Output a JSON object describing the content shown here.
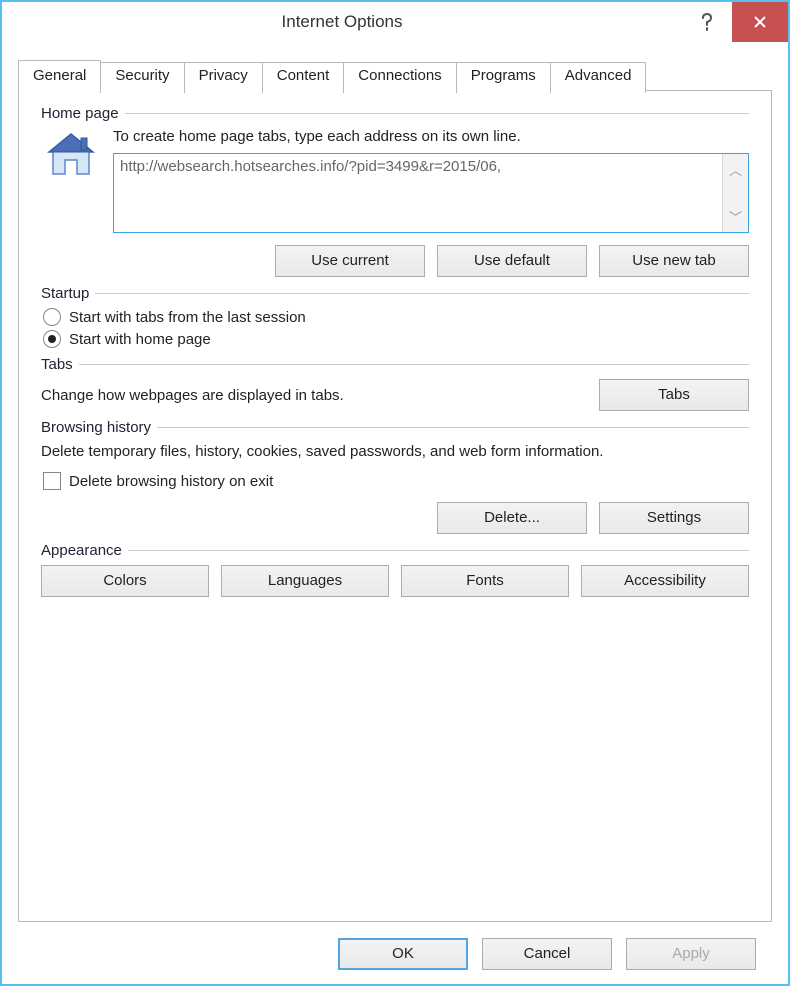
{
  "title": "Internet Options",
  "tabs": [
    "General",
    "Security",
    "Privacy",
    "Content",
    "Connections",
    "Programs",
    "Advanced"
  ],
  "homepage": {
    "group": "Home page",
    "instr": "To create home page tabs, type each address on its own line.",
    "value": "http://websearch.hotsearches.info/?pid=3499&r=2015/06,",
    "use_current": "Use current",
    "use_default": "Use default",
    "use_new_tab": "Use new tab"
  },
  "startup": {
    "group": "Startup",
    "opt_last": "Start with tabs from the last session",
    "opt_home": "Start with home page"
  },
  "tabsec": {
    "group": "Tabs",
    "text": "Change how webpages are displayed in tabs.",
    "btn": "Tabs"
  },
  "history": {
    "group": "Browsing history",
    "text": "Delete temporary files, history, cookies, saved passwords, and web form information.",
    "chk": "Delete browsing history on exit",
    "delete": "Delete...",
    "settings": "Settings"
  },
  "appearance": {
    "group": "Appearance",
    "colors": "Colors",
    "languages": "Languages",
    "fonts": "Fonts",
    "accessibility": "Accessibility"
  },
  "footer": {
    "ok": "OK",
    "cancel": "Cancel",
    "apply": "Apply"
  }
}
